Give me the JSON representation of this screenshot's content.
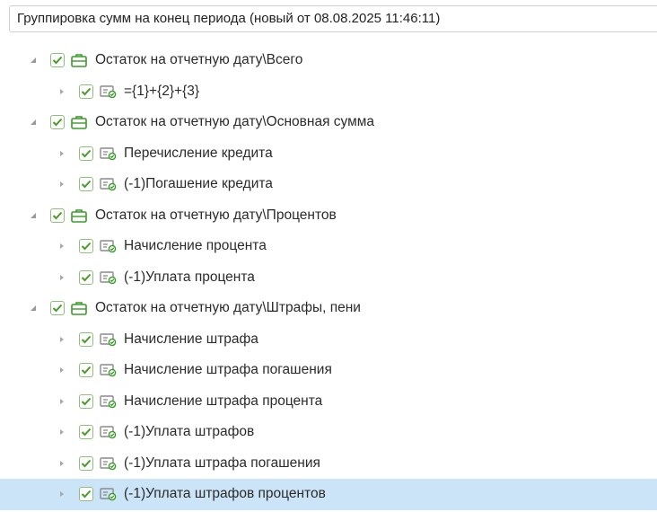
{
  "header": {
    "title": "Группировка сумм на конец периода (новый от 08.08.2025 11:46:11)"
  },
  "icons": {
    "group": "folder-group-icon",
    "item": "formula-item-icon",
    "check": "checkmark-icon",
    "expanded": "triangle-expanded-icon",
    "collapsed": "triangle-collapsed-icon"
  },
  "colors": {
    "check": "#4a9a2e",
    "selection": "#cce4f7"
  },
  "tree": {
    "groups": [
      {
        "label": "Остаток на отчетную дату\\Всего",
        "children": [
          {
            "label": "={1}+{2}+{3}"
          }
        ]
      },
      {
        "label": "Остаток на отчетную дату\\Основная сумма",
        "children": [
          {
            "label": "Перечисление кредита"
          },
          {
            "label": "(-1)Погашение кредита"
          }
        ]
      },
      {
        "label": "Остаток на отчетную дату\\Процентов",
        "children": [
          {
            "label": "Начисление процента"
          },
          {
            "label": "(-1)Уплата процента"
          }
        ]
      },
      {
        "label": "Остаток на отчетную дату\\Штрафы, пени",
        "children": [
          {
            "label": "Начисление штрафа"
          },
          {
            "label": "Начисление штрафа погашения"
          },
          {
            "label": "Начисление штрафа процента"
          },
          {
            "label": "(-1)Уплата штрафов"
          },
          {
            "label": "(-1)Уплата штрафа погашения"
          },
          {
            "label": "(-1)Уплата штрафов процентов"
          }
        ]
      }
    ]
  }
}
